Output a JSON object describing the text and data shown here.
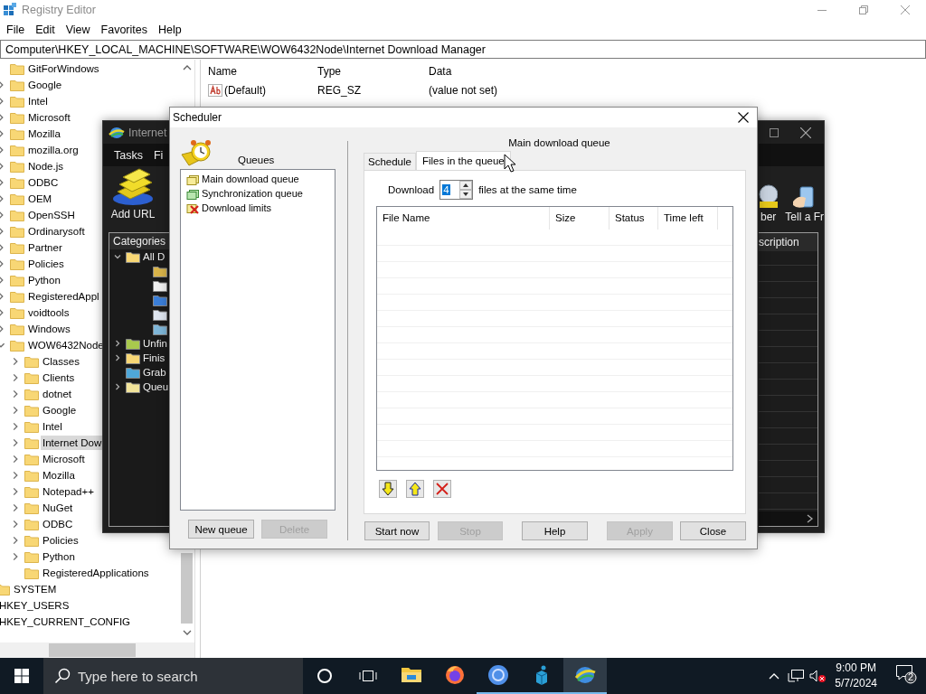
{
  "registry_editor": {
    "title": "Registry Editor",
    "menu": [
      "File",
      "Edit",
      "View",
      "Favorites",
      "Help"
    ],
    "address": "Computer\\HKEY_LOCAL_MACHINE\\SOFTWARE\\WOW6432Node\\Internet Download Manager",
    "tree": [
      {
        "children": [
          {
            "children": [
              {
                "label": "GitForWindows",
                "selected": false
              },
              {
                "label": "Google",
                "selected": false,
                "expanded": false
              },
              {
                "label": "Intel",
                "selected": false,
                "expanded": false
              },
              {
                "label": "Microsoft",
                "selected": false,
                "expanded": false
              },
              {
                "label": "Mozilla",
                "selected": false,
                "expanded": false
              },
              {
                "label": "mozilla.org",
                "selected": false,
                "expanded": false
              },
              {
                "label": "Node.js",
                "selected": false,
                "expanded": false
              },
              {
                "label": "ODBC",
                "selected": false,
                "expanded": false
              },
              {
                "label": "OEM",
                "selected": false,
                "expanded": false
              },
              {
                "label": "OpenSSH",
                "selected": false,
                "expanded": false
              },
              {
                "label": "Ordinarysoft",
                "selected": false,
                "expanded": false
              },
              {
                "label": "Partner",
                "selected": false,
                "expanded": false
              },
              {
                "label": "Policies",
                "selected": false,
                "expanded": false
              },
              {
                "label": "Python",
                "selected": false,
                "expanded": false
              },
              {
                "label": "RegisteredAppl",
                "selected": false,
                "expanded": false
              },
              {
                "label": "voidtools",
                "selected": false,
                "expanded": false
              },
              {
                "label": "Windows",
                "selected": false,
                "expanded": false
              },
              {
                "label": "WOW6432Node",
                "selected": false,
                "expanded": true,
                "children": [
                  {
                    "label": "Classes",
                    "selected": false,
                    "expanded": false
                  },
                  {
                    "label": "Clients",
                    "selected": false,
                    "expanded": false
                  },
                  {
                    "label": "dotnet",
                    "selected": false,
                    "expanded": false
                  },
                  {
                    "label": "Google",
                    "selected": false,
                    "expanded": false
                  },
                  {
                    "label": "Intel",
                    "selected": false,
                    "expanded": false
                  },
                  {
                    "label": "Internet Dow",
                    "selected": true,
                    "expanded": false
                  },
                  {
                    "label": "Microsoft",
                    "selected": false,
                    "expanded": false
                  },
                  {
                    "label": "Mozilla",
                    "selected": false,
                    "expanded": false
                  },
                  {
                    "label": "Notepad++",
                    "selected": false,
                    "expanded": false
                  },
                  {
                    "label": "NuGet",
                    "selected": false,
                    "expanded": false
                  },
                  {
                    "label": "ODBC",
                    "selected": false,
                    "expanded": false
                  },
                  {
                    "label": "Policies",
                    "selected": false,
                    "expanded": false
                  },
                  {
                    "label": "Python",
                    "selected": false,
                    "expanded": false
                  },
                  {
                    "label": "RegisteredApplications",
                    "selected": false
                  }
                ]
              }
            ]
          },
          {
            "label": "SYSTEM",
            "selected": false
          }
        ]
      },
      {
        "label": "HKEY_USERS",
        "selected": false
      },
      {
        "label": "HKEY_CURRENT_CONFIG",
        "selected": false
      }
    ],
    "values": {
      "columns": [
        "Name",
        "Type",
        "Data"
      ],
      "rows": [
        [
          "(Default)",
          "REG_SZ",
          "(value not set)"
        ]
      ]
    }
  },
  "idm_window": {
    "title": "Internet",
    "menu": [
      "Tasks",
      "Fi"
    ],
    "add_url": "Add URL",
    "toolbar_right": [
      "ber",
      "Tell a Fr"
    ],
    "categories_title": "Categories",
    "categories": [
      {
        "label": "All D",
        "expanded": true,
        "kind": "all",
        "children": [
          {
            "kind": "archive"
          },
          {
            "kind": "document"
          },
          {
            "kind": "music"
          },
          {
            "kind": "program"
          },
          {
            "kind": "video"
          }
        ]
      },
      {
        "label": "Unfin",
        "expanded": false,
        "kind": "unfinished"
      },
      {
        "label": "Finis",
        "expanded": false,
        "kind": "finished"
      },
      {
        "label": "Grab",
        "kind": "grabber"
      },
      {
        "label": "Queu",
        "expanded": false,
        "kind": "queues"
      }
    ],
    "column_header": "scription"
  },
  "scheduler": {
    "title": "Scheduler",
    "queues_label": "Queues",
    "queues": [
      {
        "label": "Main download queue",
        "kind": "main"
      },
      {
        "label": "Synchronization queue",
        "kind": "sync"
      },
      {
        "label": "Download limits",
        "kind": "limits"
      }
    ],
    "left_buttons": [
      {
        "label": "New queue",
        "disabled": false
      },
      {
        "label": "Delete",
        "disabled": true
      }
    ],
    "queue_title": "Main download queue",
    "tabs": [
      {
        "label": "Schedule",
        "selected": false
      },
      {
        "label": "Files in the queue",
        "selected": true
      }
    ],
    "concurrent": {
      "label_before": "Download",
      "value": "4",
      "label_after": "files at the same time"
    },
    "files_table": {
      "columns": [
        "File Name",
        "Size",
        "Status",
        "Time left"
      ]
    },
    "row_buttons": [
      {
        "kind": "down"
      },
      {
        "kind": "up"
      },
      {
        "kind": "remove"
      }
    ],
    "buttons": [
      {
        "label": "Start now",
        "disabled": false
      },
      {
        "label": "Stop",
        "disabled": true
      },
      {
        "label": "Help",
        "disabled": false
      },
      {
        "label": "Apply",
        "disabled": true
      },
      {
        "label": "Close",
        "disabled": false
      }
    ]
  },
  "taskbar": {
    "search": {
      "placeholder": "Type here to search"
    },
    "apps": [
      {
        "kind": "explorer",
        "running": false,
        "active": false
      },
      {
        "kind": "firefox",
        "running": false,
        "active": false
      },
      {
        "kind": "chrome",
        "running": true,
        "active": false
      },
      {
        "kind": "registry",
        "running": true,
        "active": false
      },
      {
        "kind": "idm",
        "running": true,
        "active": true
      }
    ],
    "time": "9:00 PM",
    "date": "5/7/2024",
    "notifications": "2"
  }
}
